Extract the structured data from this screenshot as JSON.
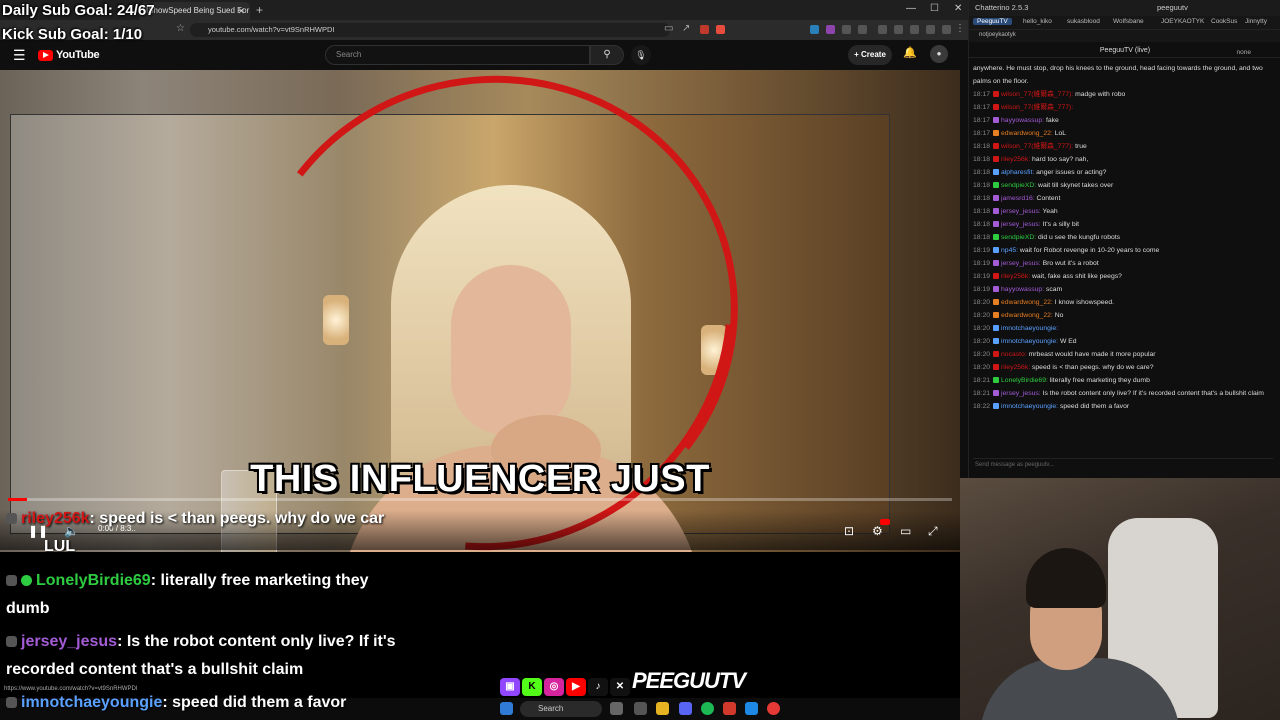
{
  "overlay": {
    "daily_goal": "Daily Sub Goal: 24/67",
    "kick_goal": "Kick Sub Goal: 1/10"
  },
  "browser": {
    "tab_title": "IShowSpeed Being Sued For $1...",
    "url": "youtube.com/watch?v=vt9SnRHWPDI",
    "status_url": "https://www.youtube.com/watch?v=vt9SnRHWPDI"
  },
  "youtube": {
    "logo_text": "YouTube",
    "search_placeholder": "Search",
    "create_label": "Create"
  },
  "video": {
    "caption": "THIS INFLUENCER JUST",
    "time": "0:00 / 8:3..",
    "progress": 0.02
  },
  "overlay_chat": [
    {
      "user": "riley256k",
      "text": ": speed is < than peegs. why do we car",
      "user_color": "#d11616"
    },
    {
      "user": "",
      "text": "LUL",
      "user_color": "#ffffff"
    },
    {
      "user": "LonelyBirdie69",
      "text": ": literally free marketing they",
      "user_color": "#2ecc40"
    },
    {
      "user": "",
      "text": "dumb",
      "user_color": "#ffffff"
    },
    {
      "user": "jersey_jesus",
      "text": ": Is the robot content only live? If it's",
      "user_color": "#a35bd6"
    },
    {
      "user": "",
      "text": "recorded content that's a bullshit claim",
      "user_color": "#ffffff"
    },
    {
      "user": "imnotchaeyoungie",
      "text": ": speed did them a favor",
      "user_color": "#5aa0ff"
    }
  ],
  "chatterino": {
    "title": "Chatterino 2.5.3",
    "user": "peeguutv",
    "tabs": [
      "PeeguuTV",
      "hello_kiko",
      "sukasblood",
      "Wolfsbane",
      "JOEYKAOTYK",
      "CookSus",
      "Jinnytty"
    ],
    "subtab": "notjoeykaotyk",
    "channel": "PeeguuTV (live)",
    "mode": "none",
    "input_placeholder": "Send message as peeguutv...",
    "messages": [
      {
        "t": "",
        "user": "",
        "text": "anywhere. He must stop, drop his knees to the ground, head facing towards the ground, and two",
        "color": "#ddd"
      },
      {
        "t": "",
        "user": "",
        "text": "palms on the floor.",
        "color": "#ddd"
      },
      {
        "t": "18:17",
        "user": "wilson_77(維爾森_777):",
        "text": "madge with robo",
        "color": "#d11616"
      },
      {
        "t": "18:17",
        "user": "wilson_77(維爾森_777):",
        "text": "",
        "color": "#d11616"
      },
      {
        "t": "18:17",
        "user": "hayyowassup:",
        "text": "fake",
        "color": "#a35bd6"
      },
      {
        "t": "18:17",
        "user": "edwardwong_22:",
        "text": "LoL",
        "color": "#e67e22"
      },
      {
        "t": "18:18",
        "user": "wilson_77(維爾森_777):",
        "text": "true",
        "color": "#d11616"
      },
      {
        "t": "18:18",
        "user": "riley256k:",
        "text": "hard too say? nah,",
        "color": "#d11616"
      },
      {
        "t": "18:18",
        "user": "alpharesfit:",
        "text": "anger issues or acting?",
        "color": "#5aa0ff"
      },
      {
        "t": "18:18",
        "user": "sendpieXD:",
        "text": "wait till skynet takes over",
        "color": "#2ecc40"
      },
      {
        "t": "18:18",
        "user": "jamesrd16:",
        "text": "Content",
        "color": "#a35bd6"
      },
      {
        "t": "18:18",
        "user": "jersey_jesus:",
        "text": "Yeah",
        "color": "#a35bd6"
      },
      {
        "t": "18:18",
        "user": "jersey_jesus:",
        "text": "It's a silly bit",
        "color": "#a35bd6"
      },
      {
        "t": "18:18",
        "user": "sendpieXD:",
        "text": "did u see the kungfu robots",
        "color": "#2ecc40"
      },
      {
        "t": "18:19",
        "user": "np45:",
        "text": "wait for Robot revenge in 10-20 years to come",
        "color": "#5aa0ff"
      },
      {
        "t": "18:19",
        "user": "jersey_jesus:",
        "text": "Bro wut it's a robot",
        "color": "#a35bd6"
      },
      {
        "t": "18:19",
        "user": "riley256k:",
        "text": "wait, fake ass shit like peegs?",
        "color": "#d11616"
      },
      {
        "t": "18:19",
        "user": "hayyowassup:",
        "text": "scam",
        "color": "#a35bd6"
      },
      {
        "t": "18:20",
        "user": "edwardwong_22:",
        "text": "I know ishowspeed.",
        "color": "#e67e22"
      },
      {
        "t": "18:20",
        "user": "edwardwong_22:",
        "text": "No",
        "color": "#e67e22"
      },
      {
        "t": "18:20",
        "user": "imnotchaeyoungie:",
        "text": "",
        "color": "#5aa0ff"
      },
      {
        "t": "18:20",
        "user": "imnotchaeyoungie:",
        "text": "W Ed",
        "color": "#5aa0ff"
      },
      {
        "t": "18:20",
        "user": "nocasto:",
        "text": "mrbeast would have made it more popular",
        "color": "#d11616"
      },
      {
        "t": "18:20",
        "user": "riley256k:",
        "text": "speed is < than peegs. why do we care?",
        "color": "#d11616"
      },
      {
        "t": "18:21",
        "user": "LonelyBirdie69:",
        "text": "literally free marketing they dumb",
        "color": "#2ecc40"
      },
      {
        "t": "18:21",
        "user": "jersey_jesus:",
        "text": "Is the robot content only live? If it's recorded content that's a bullshit claim",
        "color": "#a35bd6"
      },
      {
        "t": "18:22",
        "user": "imnotchaeyoungie:",
        "text": "speed did them a favor",
        "color": "#5aa0ff"
      }
    ]
  },
  "taskbar": {
    "search_label": "Search"
  },
  "branding": {
    "wordmark": "PEEGUUTV"
  },
  "colors": {
    "accent_red": "#ff0000",
    "chat_bg": "#0f0f0f"
  }
}
